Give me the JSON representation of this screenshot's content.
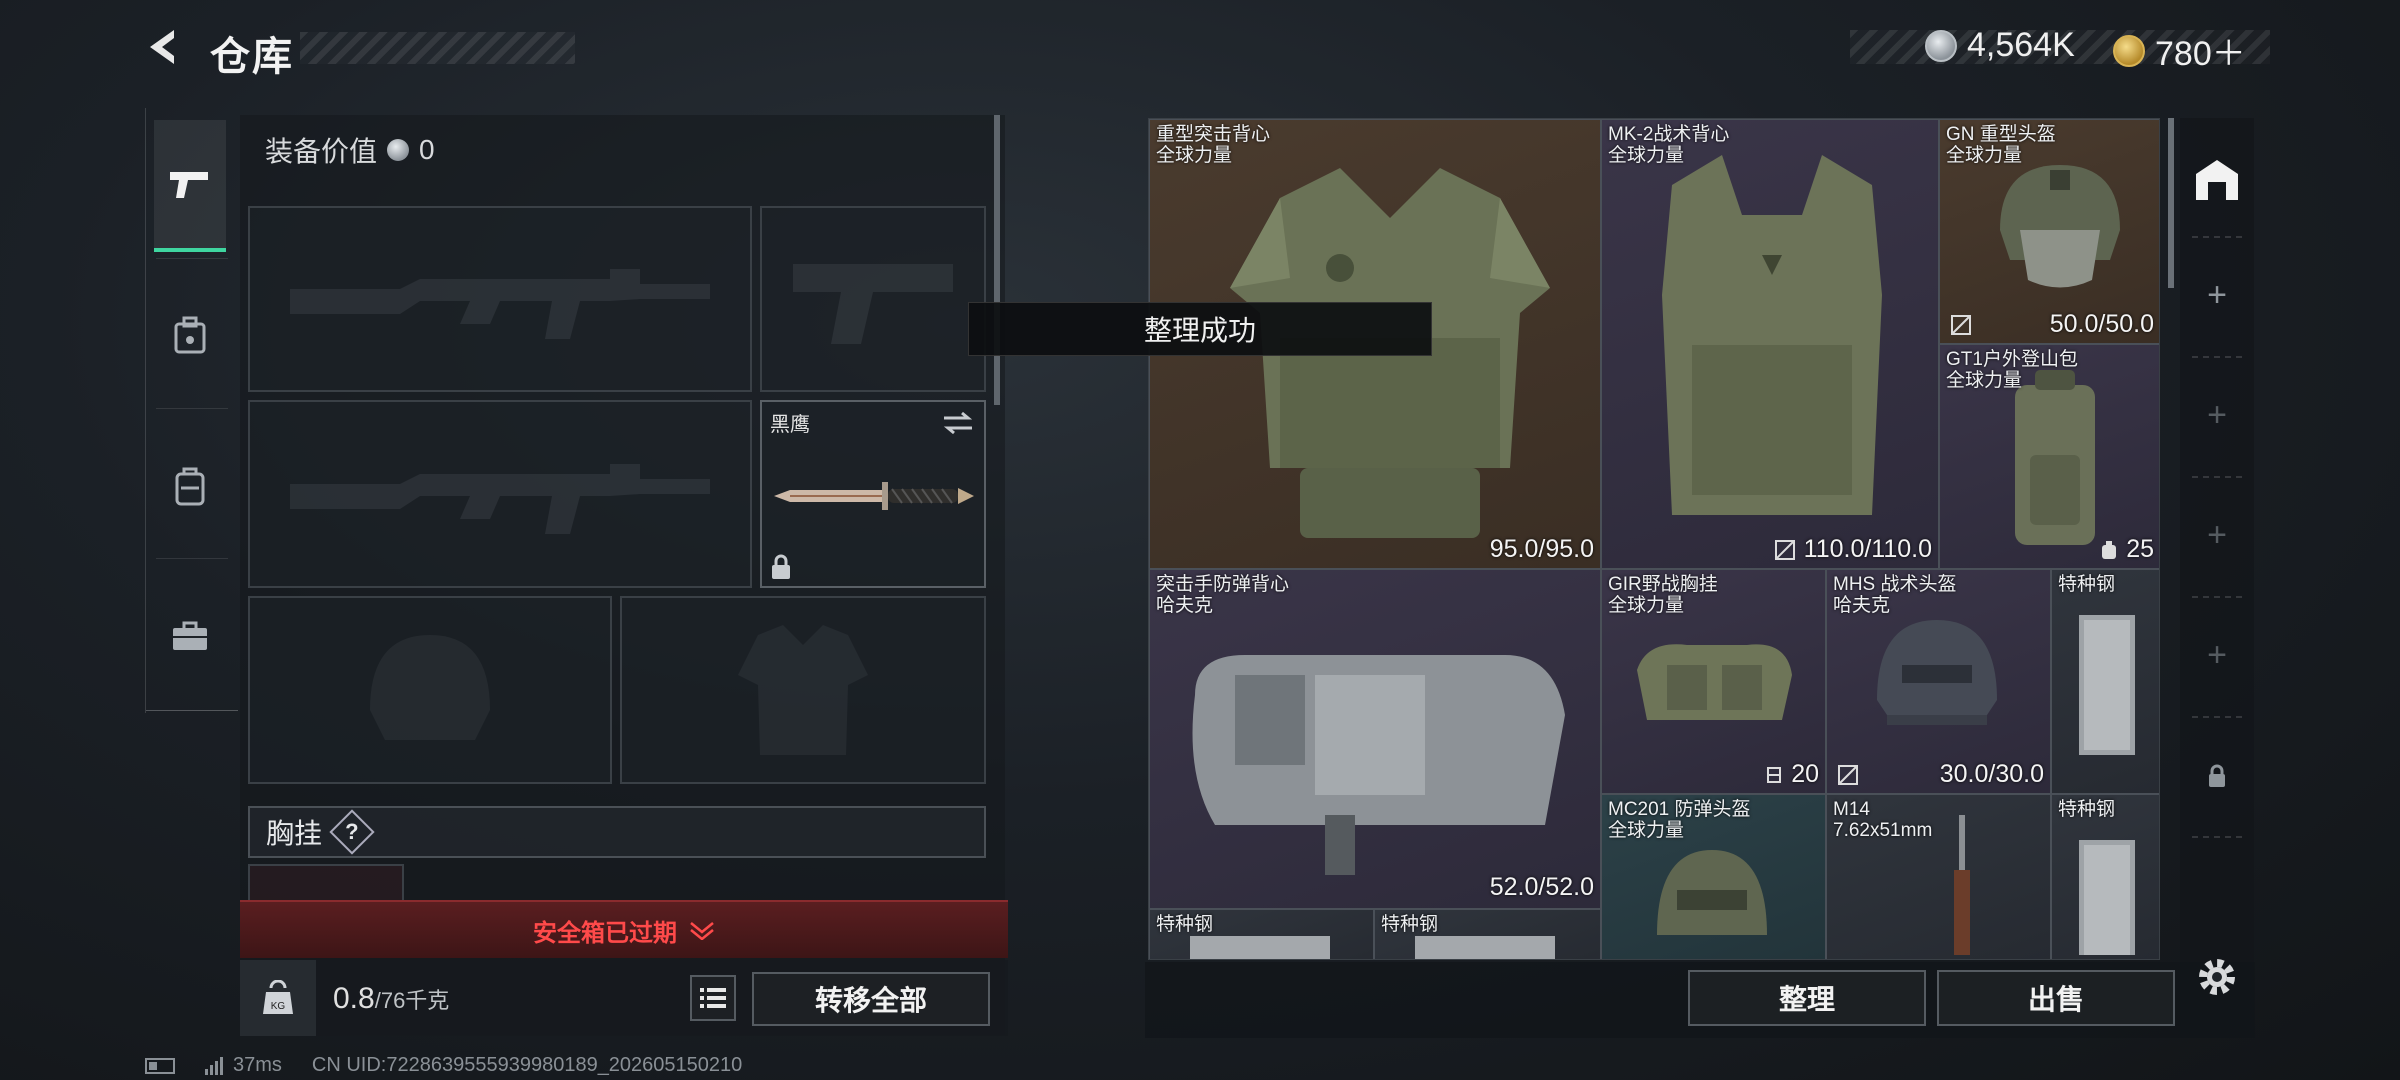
{
  "header": {
    "title": "仓库",
    "currency": [
      {
        "icon": "silver-coin-icon",
        "value": "4,564K",
        "color": "#c9cdd2"
      },
      {
        "icon": "gold-coin-icon",
        "value": "780＋",
        "color": "#d8b354"
      }
    ]
  },
  "nav": {
    "items": [
      {
        "icon": "pistol-icon",
        "active": true
      },
      {
        "icon": "safe-box-icon",
        "active": false
      },
      {
        "icon": "backpack-icon",
        "active": false
      },
      {
        "icon": "toolbox-icon",
        "active": false
      }
    ]
  },
  "loadout": {
    "equip_value_label": "装备价值",
    "equip_value": "0",
    "melee_name": "黑鹰",
    "chest_rig_label": "胸挂",
    "chest_rig_help": "?",
    "safe_box_status": "安全箱已过期",
    "weight_value": "0.8",
    "weight_max": "/76千克",
    "transfer_all": "转移全部"
  },
  "toast": "整理成功",
  "stash": {
    "items": [
      {
        "name": "重型突击背心",
        "sub": "全球力量",
        "value": "95.0/95.0",
        "rarity_color": "#4a3b2e"
      },
      {
        "name": "MK-2战术背心",
        "sub": "全球力量",
        "value": "110.0/110.0",
        "rarity_color": "#3a3548"
      },
      {
        "name": "GN 重型头盔",
        "sub": "全球力量",
        "value": "50.0/50.0",
        "rarity_color": "#4a3b2e"
      },
      {
        "name": "GT1户外登山包",
        "sub": "全球力量",
        "value": "25",
        "rarity_color": "#3a3548"
      },
      {
        "name": "突击手防弹背心",
        "sub": "哈夫克",
        "value": "52.0/52.0",
        "rarity_color": "#3a3548"
      },
      {
        "name": "GIR野战胸挂",
        "sub": "全球力量",
        "value": "20",
        "rarity_color": "#3a3548"
      },
      {
        "name": "MHS 战术头盔",
        "sub": "哈夫克",
        "value": "30.0/30.0",
        "rarity_color": "#3a3548"
      },
      {
        "name": "特种钢",
        "sub": "",
        "value": "",
        "rarity_color": "#30353d"
      },
      {
        "name": "MC201 防弹头盔",
        "sub": "全球力量",
        "value": "",
        "rarity_color": "#2c4148"
      },
      {
        "name": "M14",
        "sub": "7.62x51mm",
        "value": "",
        "rarity_color": "#30353d"
      },
      {
        "name": "特种钢",
        "sub": "",
        "value": "",
        "rarity_color": "#30353d"
      },
      {
        "name": "特种钢",
        "sub": "",
        "value": "",
        "rarity_color": "#30353d"
      },
      {
        "name": "特种钢",
        "sub": "",
        "value": "",
        "rarity_color": "#30353d"
      }
    ],
    "sort_button": "整理",
    "sell_button": "出售"
  },
  "status_bar": {
    "ping": "37ms",
    "uid": "CN UID:7228639555939980189_202605150210"
  },
  "colors": {
    "active_tab": "#3fd6a0",
    "warning": "#ff4a4a"
  }
}
